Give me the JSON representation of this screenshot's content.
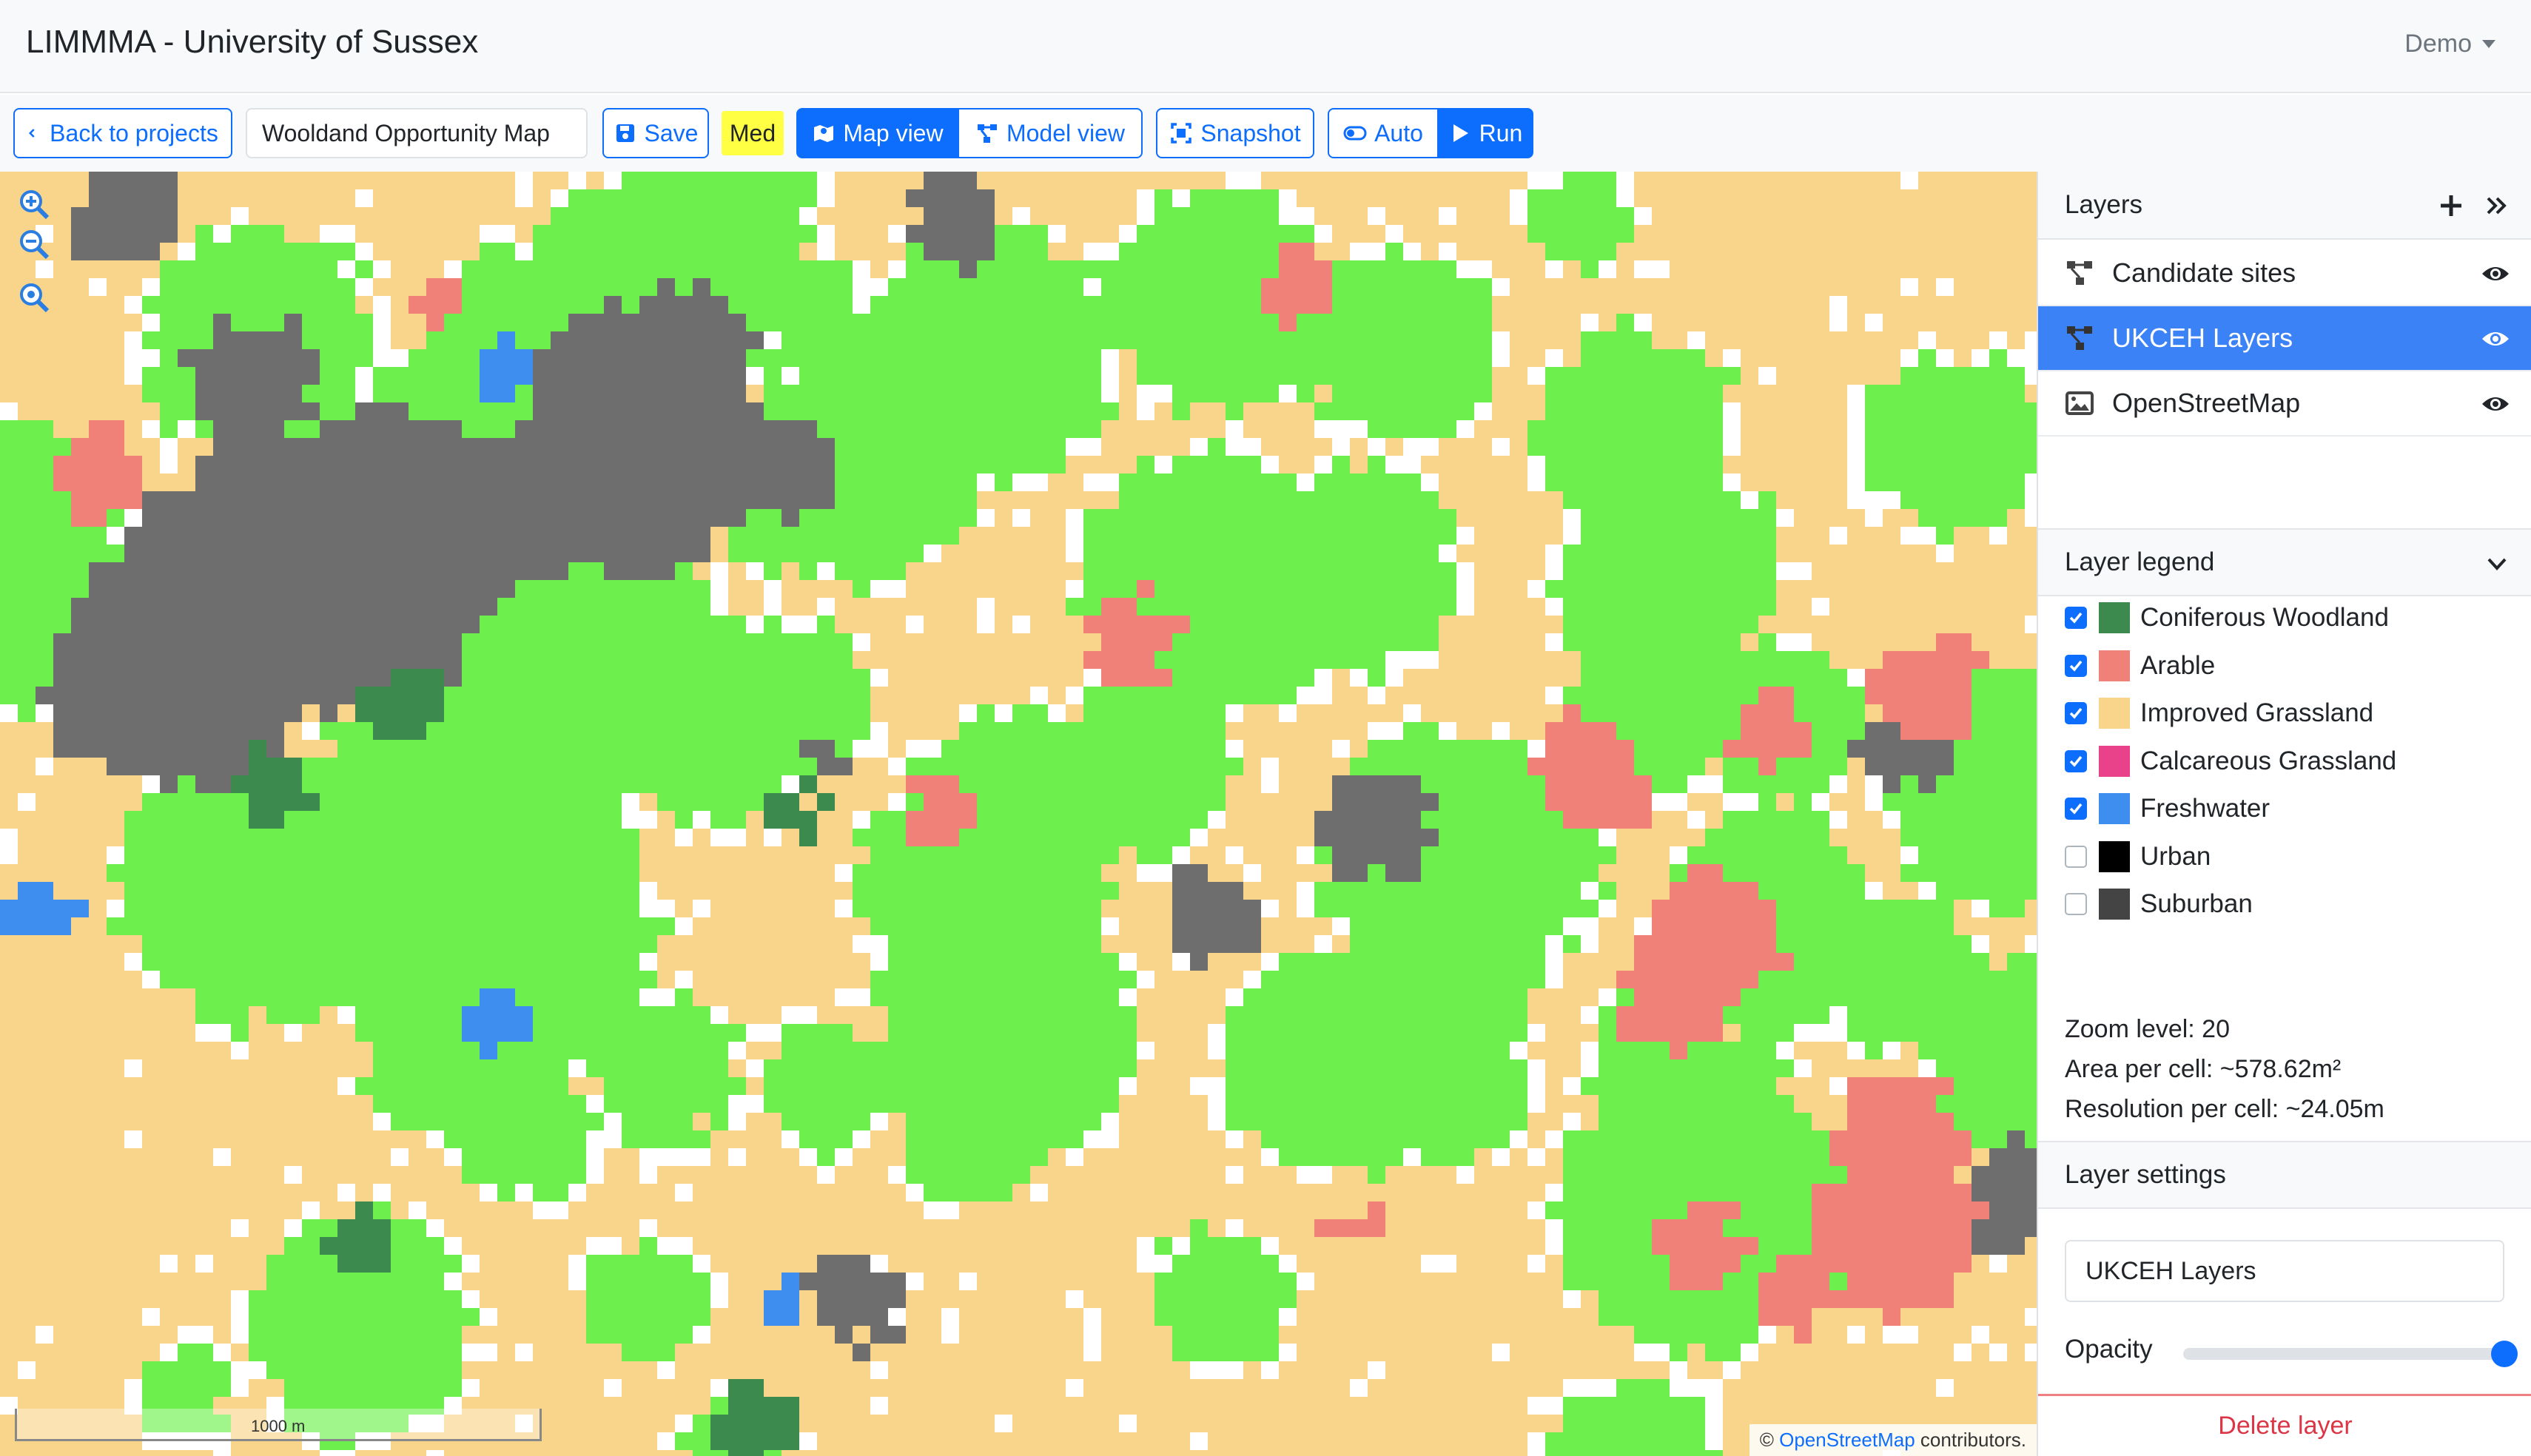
{
  "app": {
    "title": "LIMMMA - University of Sussex",
    "user_menu": "Demo"
  },
  "toolbar": {
    "back_label": "Back to projects",
    "project_name": "Wooldand Opportunity Map",
    "save_label": "Save",
    "quality_badge": "Med",
    "map_view_label": "Map view",
    "model_view_label": "Model view",
    "snapshot_label": "Snapshot",
    "auto_label": "Auto",
    "run_label": "Run"
  },
  "map": {
    "scale_label": "1000 m",
    "attribution_prefix": "©",
    "attribution_link": "OpenStreetMap",
    "attribution_suffix": "contributors.",
    "icons": [
      "zoom-in-icon",
      "zoom-out-icon",
      "zoom-fit-icon"
    ],
    "colors": {
      "improved_grassland": "#f9d48b",
      "grass_green": "#6df04d",
      "arable": "#ef8179",
      "suburban": "#6e6e6e",
      "coniferous": "#3c8a4e",
      "freshwater": "#3e8eef",
      "white": "#ffffff"
    }
  },
  "layers": {
    "header": "Layers",
    "items": [
      {
        "label": "Candidate sites",
        "icon": "model-graph-icon",
        "selected": false
      },
      {
        "label": "UKCEH Layers",
        "icon": "model-graph-icon",
        "selected": true
      },
      {
        "label": "OpenStreetMap",
        "icon": "image-icon",
        "selected": false
      }
    ]
  },
  "legend": {
    "header": "Layer legend",
    "items": [
      {
        "label": "Coniferous Woodland",
        "color": "#3c8a4e",
        "checked": true
      },
      {
        "label": "Arable",
        "color": "#ef8179",
        "checked": true
      },
      {
        "label": "Improved Grassland",
        "color": "#f9d48b",
        "checked": true
      },
      {
        "label": "Calcareous Grassland",
        "color": "#e9428b",
        "checked": true
      },
      {
        "label": "Freshwater",
        "color": "#3e8eef",
        "checked": true
      },
      {
        "label": "Urban",
        "color": "#000000",
        "checked": false
      },
      {
        "label": "Suburban",
        "color": "#444444",
        "checked": false
      }
    ],
    "zoom_level": "Zoom level: 20",
    "area_per_cell": "Area per cell: ~578.62m²",
    "resolution_per_cell": "Resolution per cell: ~24.05m"
  },
  "settings": {
    "header": "Layer settings",
    "layer_name": "UKCEH Layers",
    "opacity_label": "Opacity",
    "opacity_value": 1.0,
    "delete_label": "Delete layer"
  }
}
